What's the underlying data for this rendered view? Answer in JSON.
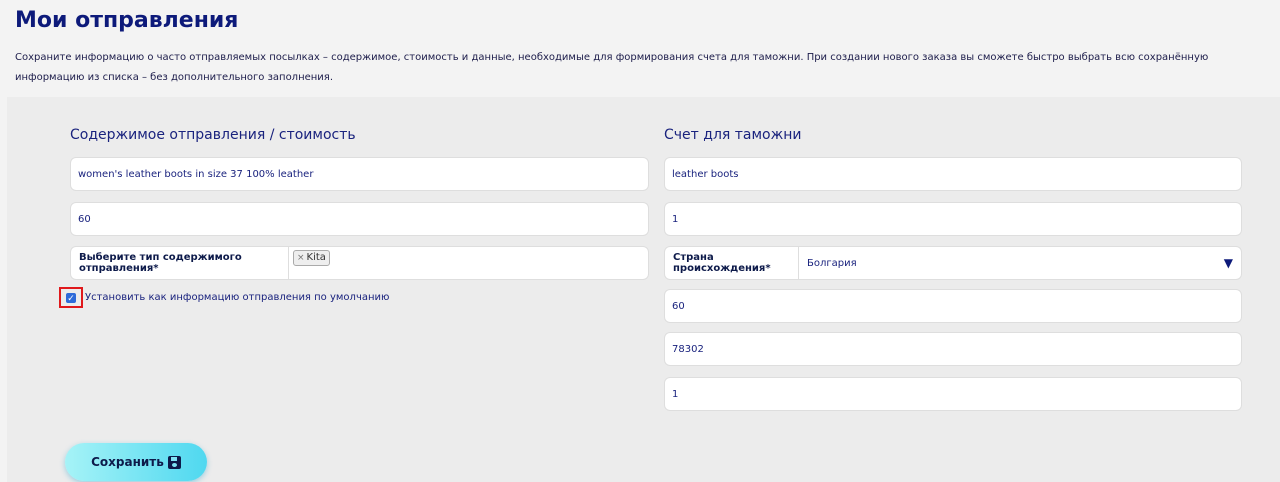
{
  "page": {
    "title": "Мои отправления",
    "intro": "Сохраните информацию о часто отправляемых посылках – содержимое, стоимость и данные, необходимые для формирования счета для таможни. При создании нового заказа вы сможете быстро выбрать всю сохранённую информацию из списка – без дополнительного заполнения."
  },
  "contents": {
    "title": "Содержимое отправления / стоимость",
    "description_value": "women's leather boots in size 37 100% leather",
    "value_value": "60",
    "type_label": "Выберите тип содержимого отправления*",
    "type_tag": "Kita",
    "type_tag_remove": "×",
    "default_checkbox_label": "Установить как информацию отправления по умолчанию",
    "default_checked": true
  },
  "customs": {
    "title": "Счет для таможни",
    "item_value": "leather boots",
    "quantity_value": "1",
    "origin_label": "Страна происхождения*",
    "origin_value": "Болгария",
    "field3_value": "60",
    "field4_value": "78302",
    "field5_value": "1"
  },
  "actions": {
    "save_label": "Сохранить",
    "save_icon": "floppy-disk-icon"
  },
  "colors": {
    "title": "#0d1a7a",
    "accent": "#4fd8f0",
    "highlight": "#e0191c"
  }
}
